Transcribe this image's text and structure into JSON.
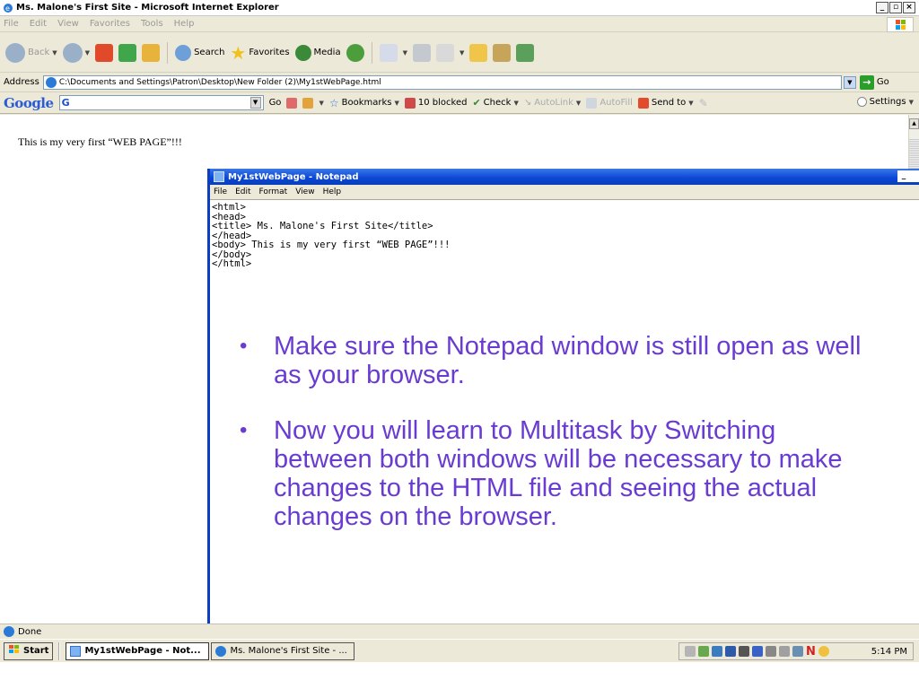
{
  "ie": {
    "title": "Ms. Malone's First Site - Microsoft Internet Explorer",
    "menu": [
      "File",
      "Edit",
      "View",
      "Favorites",
      "Tools",
      "Help"
    ],
    "toolbar": {
      "back": "Back",
      "search": "Search",
      "favorites": "Favorites",
      "media": "Media"
    },
    "address": {
      "label": "Address",
      "value": "C:\\Documents and Settings\\Patron\\Desktop\\New Folder (2)\\My1stWebPage.html",
      "go": "Go"
    },
    "google": {
      "logo": "Google",
      "search_prefix": "G",
      "go": "Go",
      "bookmarks": "Bookmarks",
      "blocked": "10 blocked",
      "check": "Check",
      "autolink": "AutoLink",
      "autofill": "AutoFill",
      "sendto": "Send to",
      "settings": "Settings"
    },
    "page_text": "This is my very first “WEB PAGE”!!!",
    "status": "Done",
    "controls": {
      "min": "_",
      "max": "▫",
      "close": "×"
    }
  },
  "notepad": {
    "title": "My1stWebPage - Notepad",
    "menu": [
      "File",
      "Edit",
      "Format",
      "View",
      "Help"
    ],
    "content": "<html>\n<head>\n<title> Ms. Malone's First Site</title>\n</head>\n<body> This is my very first “WEB PAGE”!!!\n</body>\n</html>"
  },
  "bullets": [
    "Make sure the Notepad window is still open as well as your browser.",
    "Now you will learn to Multitask by Switching between both windows will be necessary to make changes to the HTML file and seeing the actual changes on the browser."
  ],
  "taskbar": {
    "start": "Start",
    "tasks": [
      "My1stWebPage - Not...",
      "Ms. Malone's First Site - ..."
    ],
    "clock": "5:14 PM",
    "tray_n": "N"
  },
  "colors": {
    "bullet_text": "#6a3bd1",
    "notepad_title": "#0a46d6",
    "ie_chrome": "#ece9d8"
  }
}
